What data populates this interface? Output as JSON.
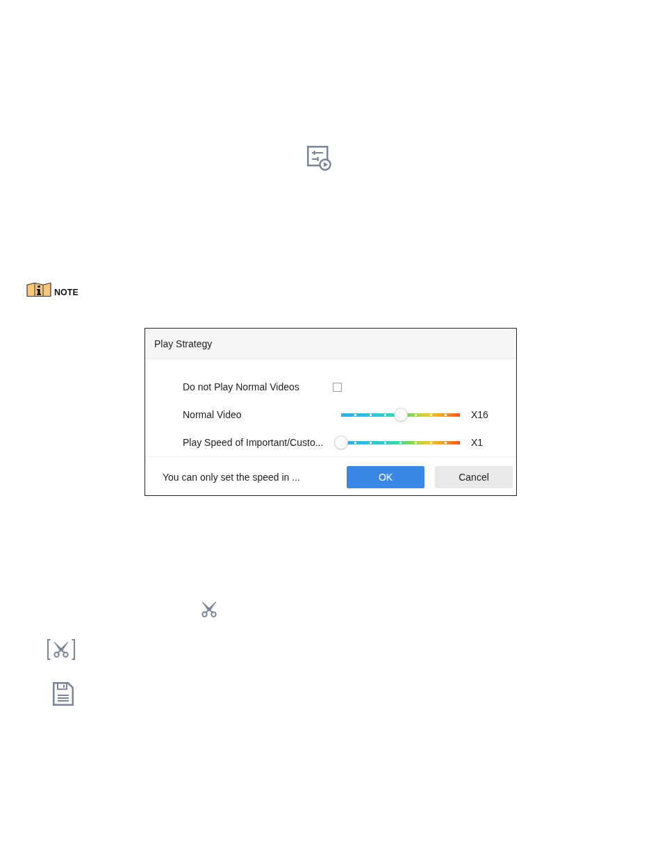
{
  "note": {
    "label": "NOTE"
  },
  "dialog": {
    "title": "Play Strategy",
    "rows": [
      {
        "kind": "checkbox",
        "label": "Do not Play Normal Videos",
        "checked": false
      },
      {
        "kind": "slider",
        "label": "Normal Video",
        "level": 0.5,
        "reading": "X16"
      },
      {
        "kind": "slider",
        "label": "Play Speed of Important/Custo...",
        "level": 0,
        "reading": "X1"
      }
    ],
    "hint": "You can only set the speed in ...",
    "buttons": [
      {
        "kind": "primary",
        "label": "OK"
      },
      {
        "kind": "secondary",
        "label": "Cancel"
      }
    ]
  }
}
